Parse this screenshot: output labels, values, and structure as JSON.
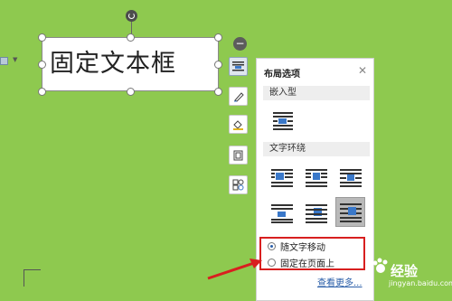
{
  "textbox": {
    "text": "固定文本框"
  },
  "panel": {
    "title": "布局选项",
    "section_inline": "嵌入型",
    "section_wrap": "文字环绕",
    "options": [
      {
        "label": "随文字移动",
        "checked": true
      },
      {
        "label": "固定在页面上",
        "checked": false
      }
    ],
    "see_more": "查看更多..."
  },
  "toolbar": {
    "collapse": "−",
    "icons": [
      "layout-options-icon",
      "pen-icon",
      "fill-icon",
      "border-icon",
      "shapes-icon"
    ]
  },
  "wrap_icons": [
    "square-wrap-icon",
    "tight-wrap-icon",
    "through-wrap-icon",
    "top-bottom-wrap-icon",
    "behind-text-icon",
    "in-front-of-text-icon"
  ],
  "watermark": {
    "text": "经验",
    "sub": "jingyan.baidu.com"
  },
  "colors": {
    "background": "#8ec94f",
    "highlight": "#d81f1f",
    "link": "#2a5ea8"
  }
}
